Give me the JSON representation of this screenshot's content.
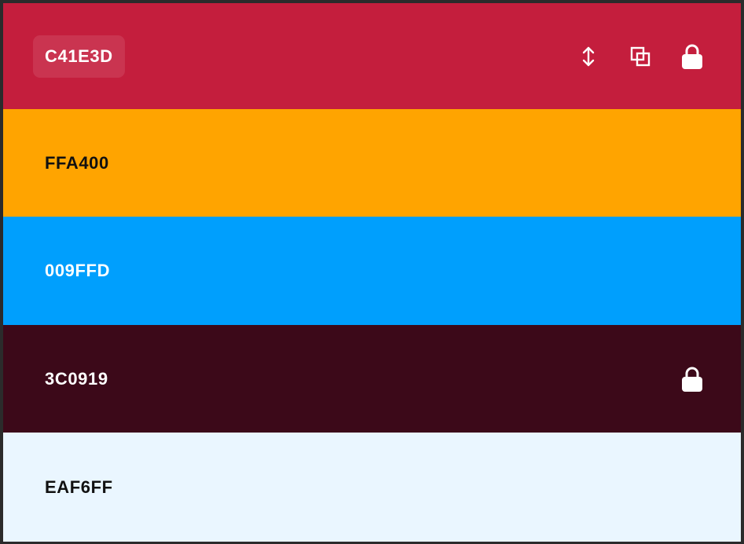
{
  "palette": {
    "swatches": [
      {
        "hex": "C41E3D",
        "color": "#C41E3D",
        "text_tone": "light",
        "locked": true,
        "show_actions": true
      },
      {
        "hex": "FFA400",
        "color": "#FFA400",
        "text_tone": "dark",
        "locked": false,
        "show_actions": false
      },
      {
        "hex": "009FFD",
        "color": "#009FFD",
        "text_tone": "light",
        "locked": false,
        "show_actions": false
      },
      {
        "hex": "3C0919",
        "color": "#3C0919",
        "text_tone": "light",
        "locked": true,
        "show_actions": false
      },
      {
        "hex": "EAF6FF",
        "color": "#EAF6FF",
        "text_tone": "dark",
        "locked": false,
        "show_actions": false
      }
    ],
    "icons": {
      "drag": "drag-vertical-icon",
      "copy": "copy-icon",
      "lock": "lock-icon"
    }
  }
}
